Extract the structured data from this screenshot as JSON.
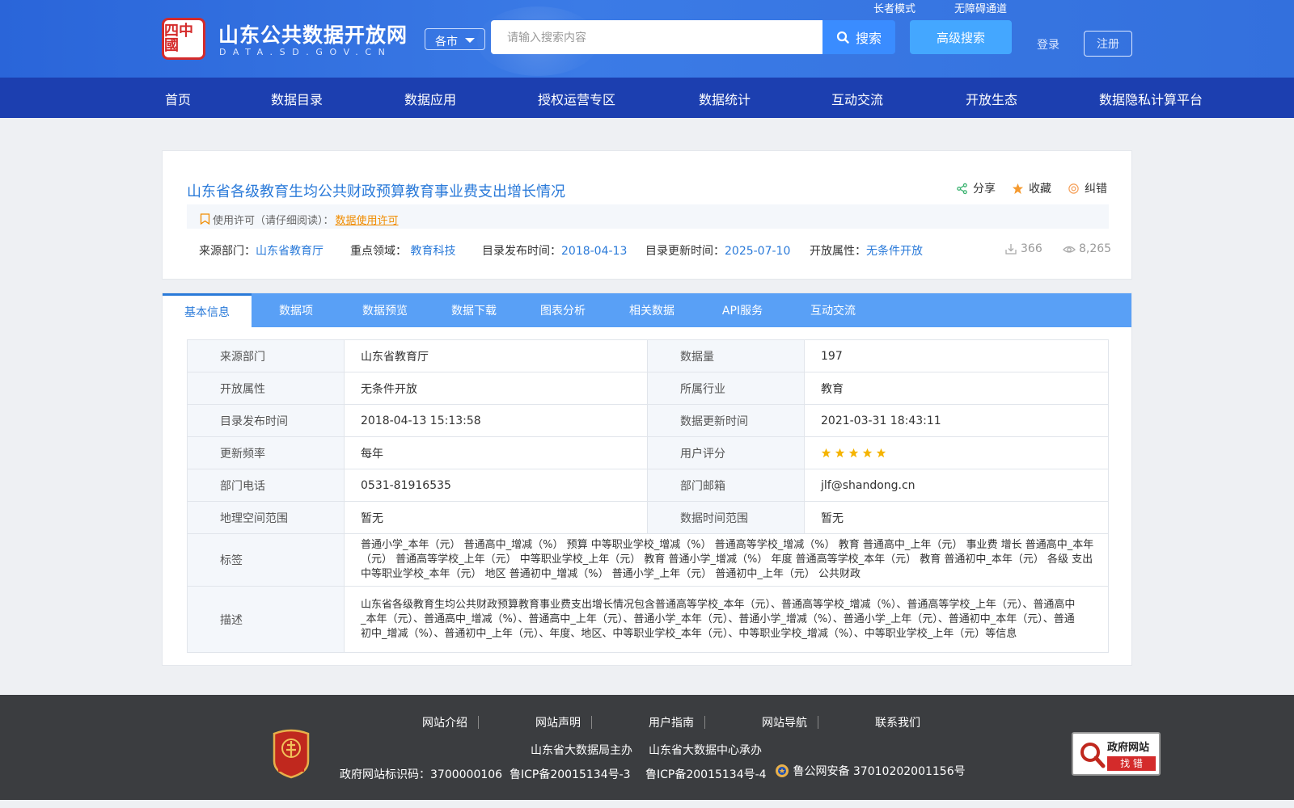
{
  "header": {
    "logo_chars": "四中國",
    "site_title": "山东公共数据开放网",
    "site_domain": "DATA.SD.GOV.CN",
    "city_select": "各市",
    "search_placeholder": "请输入搜索内容",
    "search_label": "搜索",
    "advanced_search_label": "高级搜索",
    "elder_mode": "长者模式",
    "accessibility": "无障碍通道",
    "login": "登录",
    "register": "注册"
  },
  "nav": {
    "items": [
      "首页",
      "数据目录",
      "数据应用",
      "授权运营专区",
      "数据统计",
      "互动交流",
      "开放生态",
      "数据隐私计算平台"
    ]
  },
  "dataset": {
    "title": "山东省各级教育生均公共财政预算教育事业费支出增长情况",
    "actions": {
      "share": "分享",
      "favorite": "收藏",
      "report": "纠错"
    },
    "license_prefix": "使用许可（请仔细阅读）：",
    "license_link": "数据使用许可",
    "meta": {
      "source_label": "来源部门：",
      "source": "山东省教育厅",
      "domain_label": "重点领域：",
      "domain": "教育科技",
      "publish_label": "目录发布时间：",
      "publish": "2018-04-13",
      "update_label": "目录更新时间：",
      "update": "2025-07-10",
      "open_label": "开放属性：",
      "open": "无条件开放"
    },
    "downloads": "366",
    "views": "8,265"
  },
  "tabs": [
    "基本信息",
    "数据项",
    "数据预览",
    "数据下载",
    "图表分析",
    "相关数据",
    "API服务",
    "互动交流"
  ],
  "info": {
    "r1": {
      "l1": "来源部门",
      "v1": "山东省教育厅",
      "l2": "数据量",
      "v2": "197"
    },
    "r2": {
      "l1": "开放属性",
      "v1": "无条件开放",
      "l2": "所属行业",
      "v2": "教育"
    },
    "r3": {
      "l1": "目录发布时间",
      "v1": "2018-04-13 15:13:58",
      "l2": "数据更新时间",
      "v2": "2021-03-31 18:43:11"
    },
    "r4": {
      "l1": "更新频率",
      "v1": "每年",
      "l2": "用户评分",
      "rating": 5,
      "rating_max": 5
    },
    "r5": {
      "l1": "部门电话",
      "v1": "0531-81916535",
      "l2": "部门邮箱",
      "v2": "jlf@shandong.cn"
    },
    "r6": {
      "l1": "地理空间范围",
      "v1": "暂无",
      "l2": "数据时间范围",
      "v2": "暂无"
    },
    "tags_label": "标签",
    "tags": "普通小学_本年（元） 普通高中_增减（%） 预算 中等职业学校_增减（%） 普通高等学校_增减（%） 教育 普通高中_上年（元） 事业费 增长 普通高中_本年（元） 普通高等学校_上年（元） 中等职业学校_上年（元） 教育 普通小学_增减（%） 年度 普通高等学校_本年（元） 教育 普通初中_本年（元） 各级 支出 中等职业学校_本年（元） 地区 普通初中_增减（%） 普通小学_上年（元） 普通初中_上年（元） 公共财政",
    "desc_label": "描述",
    "desc": "山东省各级教育生均公共财政预算教育事业费支出增长情况包含普通高等学校_本年（元）、普通高等学校_增减（%）、普通高等学校_上年（元）、普通高中_本年（元）、普通高中_增减（%）、普通高中_上年（元）、普通小学_本年（元）、普通小学_增减（%）、普通小学_上年（元）、普通初中_本年（元）、普通初中_增减（%）、普通初中_上年（元）、年度、地区、中等职业学校_本年（元）、中等职业学校_增减（%）、中等职业学校_上年（元）等信息"
  },
  "footer": {
    "links": [
      "网站介绍",
      "网站声明",
      "用户指南",
      "网站导航",
      "联系我们"
    ],
    "host": "山东省大数据局主办",
    "undertake": "山东省大数据中心承办",
    "gov_id": "政府网站标识码：3700000106",
    "icp1": "鲁ICP备20015134号-3",
    "icp2": "鲁ICP备20015134号-4",
    "police": "鲁公网安备 37010202001156号",
    "badge_text": "党政机关",
    "error_title": "政府网站",
    "error_btn": "找 错"
  },
  "colors": {
    "header": "#3370dd",
    "nav": "#1c3fb0",
    "tabbar": "#59a0f6",
    "link": "#2a7ad9",
    "star": "#f5b400",
    "license": "#f08c00"
  }
}
